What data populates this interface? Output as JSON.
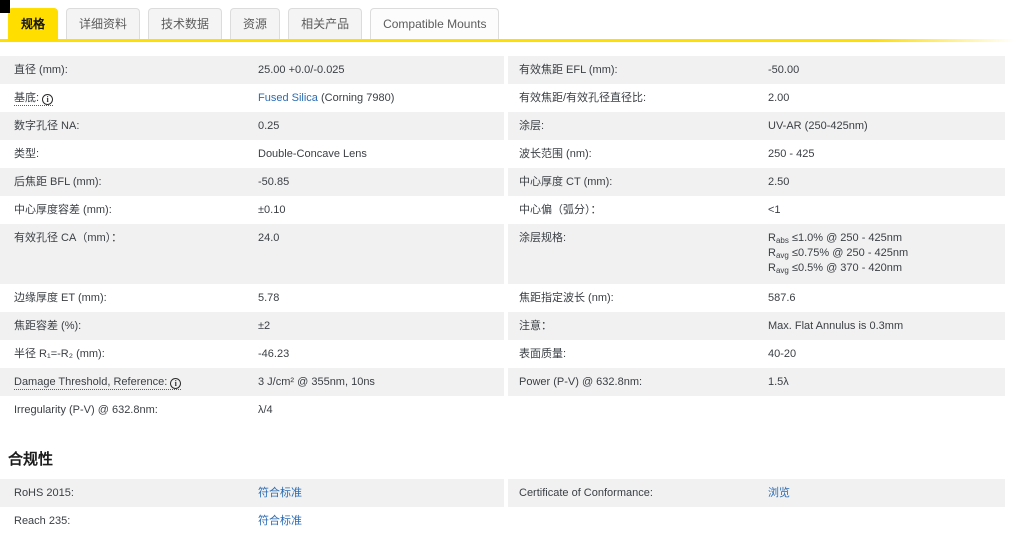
{
  "colors": {
    "accent_yellow": "#ffde00",
    "row_gray": "#f1f1f1",
    "link_blue": "#2b6cb5"
  },
  "tabs": {
    "items": [
      {
        "label": "规格",
        "active": true
      },
      {
        "label": "详细资料",
        "active": false
      },
      {
        "label": "技术数据",
        "active": false
      },
      {
        "label": "资源",
        "active": false
      },
      {
        "label": "相关产品",
        "active": false
      },
      {
        "label": "Compatible Mounts",
        "active": false
      }
    ]
  },
  "specs": {
    "rows": [
      {
        "l_label": "直径 (mm):",
        "l_value": "25.00 +0.0/-0.025",
        "r_label": "有效焦距 EFL (mm):",
        "r_value": "-50.00"
      },
      {
        "l_label": "基底:",
        "l_info_icon": "info-icon",
        "l_value_link": "Fused Silica",
        "l_value_rest": " (Corning 7980)",
        "r_label": "有效焦距/有效孔径直径比:",
        "r_value": "2.00"
      },
      {
        "l_label": "数字孔径 NA:",
        "l_value": "0.25",
        "r_label": "涂层:",
        "r_value": "UV-AR (250-425nm)"
      },
      {
        "l_label": "类型:",
        "l_value": "Double-Concave Lens",
        "r_label": "波长范围 (nm):",
        "r_value": "250 - 425"
      },
      {
        "l_label": "后焦距 BFL (mm):",
        "l_value": "-50.85",
        "r_label": "中心厚度 CT (mm):",
        "r_value": "2.50"
      },
      {
        "l_label": "中心厚度容差 (mm):",
        "l_value": "±0.10",
        "r_label": "中心偏（弧分）：",
        "r_value": "<1"
      },
      {
        "l_label": "有效孔径 CA（mm）：",
        "l_value": "24.0",
        "r_label": "涂层规格:",
        "r_value_lines": [
          {
            "base": "R",
            "sub": "abs",
            "rest": " ≤1.0% @ 250 - 425nm"
          },
          {
            "base": "R",
            "sub": "avg",
            "rest": " ≤0.75% @ 250 - 425nm"
          },
          {
            "base": "R",
            "sub": "avg",
            "rest": " ≤0.5% @ 370 - 420nm"
          }
        ]
      },
      {
        "l_label": "边缘厚度 ET (mm):",
        "l_value": "5.78",
        "r_label": "焦距指定波长 (nm):",
        "r_value": "587.6"
      },
      {
        "l_label": "焦距容差 (%):",
        "l_value": "±2",
        "r_label": "注意：",
        "r_value": "Max. Flat Annulus is 0.3mm"
      },
      {
        "l_label": "半径 R₁=-R₂ (mm):",
        "l_value": "-46.23",
        "r_label": "表面质量:",
        "r_value": "40-20"
      },
      {
        "l_label": "Damage Threshold, Reference:",
        "l_info_icon": "info-icon",
        "l_value": "3 J/cm² @ 355nm, 10ns",
        "r_label": "Power (P-V) @ 632.8nm:",
        "r_value": "1.5λ"
      },
      {
        "l_label": "Irregularity (P-V) @ 632.8nm:",
        "l_value": "λ/4",
        "r_label": "",
        "r_value": ""
      }
    ]
  },
  "compliance": {
    "heading": "合规性",
    "rows": [
      {
        "l_label": "RoHS 2015:",
        "l_link": "符合标准",
        "r_label": "Certificate of Conformance:",
        "r_link": "浏览"
      },
      {
        "l_label": "Reach 235:",
        "l_link": "符合标准",
        "r_label": "",
        "r_link": ""
      }
    ]
  }
}
